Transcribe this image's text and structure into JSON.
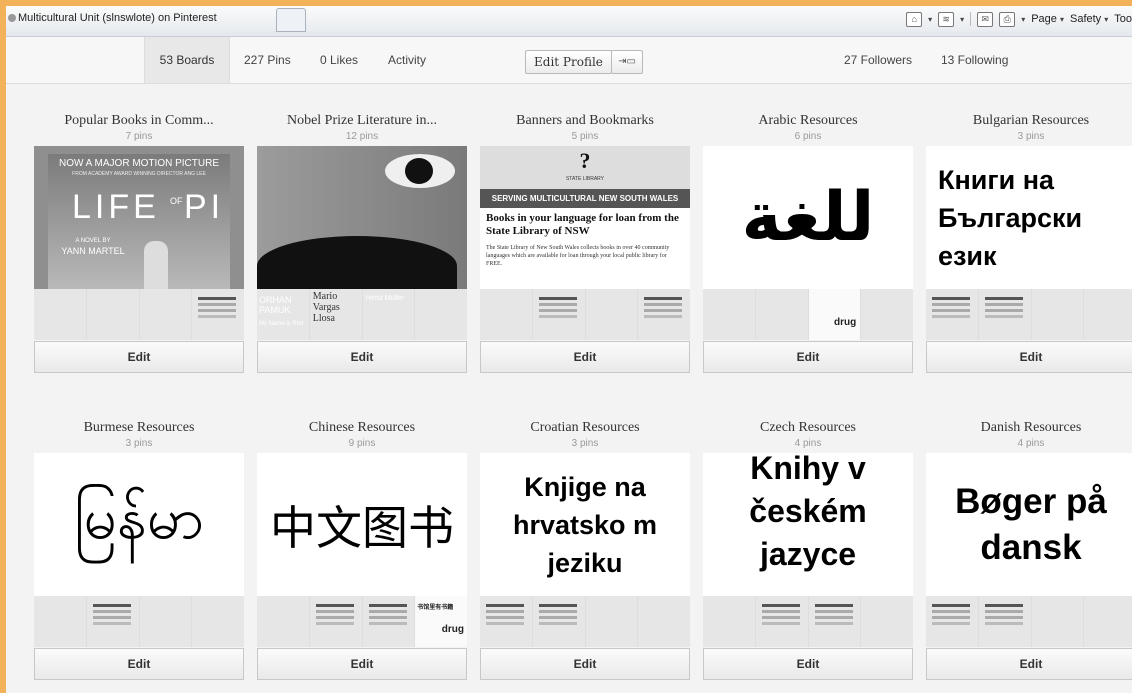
{
  "browser": {
    "tab_title": "Multicultural Unit (slnswlote) on Pinterest",
    "commands": [
      "Page",
      "Safety",
      "Too"
    ]
  },
  "nav": {
    "boards": "53 Boards",
    "pins": "227 Pins",
    "likes": "0 Likes",
    "activity": "Activity",
    "edit_profile": "Edit Profile",
    "followers": "27 Followers",
    "following": "13 Following"
  },
  "edit_label": "Edit",
  "boards": [
    {
      "title": "Popular Books in Comm...",
      "pins": "7 pins",
      "cover": [
        "NOW A MAJOR MOTION PICTURE",
        "FROM ACADEMY AWARD WINNING DIRECTOR ANG LEE",
        "LIFE",
        "OF",
        "PI",
        "A NOVEL BY",
        "YANN MARTEL"
      ]
    },
    {
      "title": "Nobel Prize Literature in...",
      "pins": "12 pins",
      "thumbs": [
        "ORHAN PAMUK",
        "My Name is Red",
        "Mario Vargas Llosa",
        "Herta Müller"
      ]
    },
    {
      "title": "Banners and Bookmarks",
      "pins": "5 pins",
      "cover": [
        "?",
        "STATE LIBRARY",
        "SERVING MULTICULTURAL NEW SOUTH WALES",
        "Books in your language for loan from the State Library of NSW",
        "The State Library of New South Wales collects books in over 40 community languages which are available for loan through your local public library for FREE."
      ]
    },
    {
      "title": "Arabic Resources",
      "pins": "6 pins",
      "cover": [
        "للغة"
      ],
      "thumbs": [
        "drug"
      ]
    },
    {
      "title": "Bulgarian Resources",
      "pins": "3 pins",
      "cover": [
        "Книги на Български език"
      ]
    },
    {
      "title": "Burmese Resources",
      "pins": "3 pins",
      "cover": [
        "မြန်မာ"
      ]
    },
    {
      "title": "Chinese Resources",
      "pins": "9 pins",
      "cover": [
        "中文图书"
      ],
      "thumbs": [
        "书馆里有书籍",
        "drug"
      ]
    },
    {
      "title": "Croatian Resources",
      "pins": "3 pins",
      "cover": [
        "Knjige na hrvatsko m jeziku"
      ]
    },
    {
      "title": "Czech Resources",
      "pins": "4 pins",
      "cover": [
        "Knihy v českém jazyce"
      ]
    },
    {
      "title": "Danish Resources",
      "pins": "4 pins",
      "cover": [
        "Bøger på dansk"
      ]
    }
  ]
}
